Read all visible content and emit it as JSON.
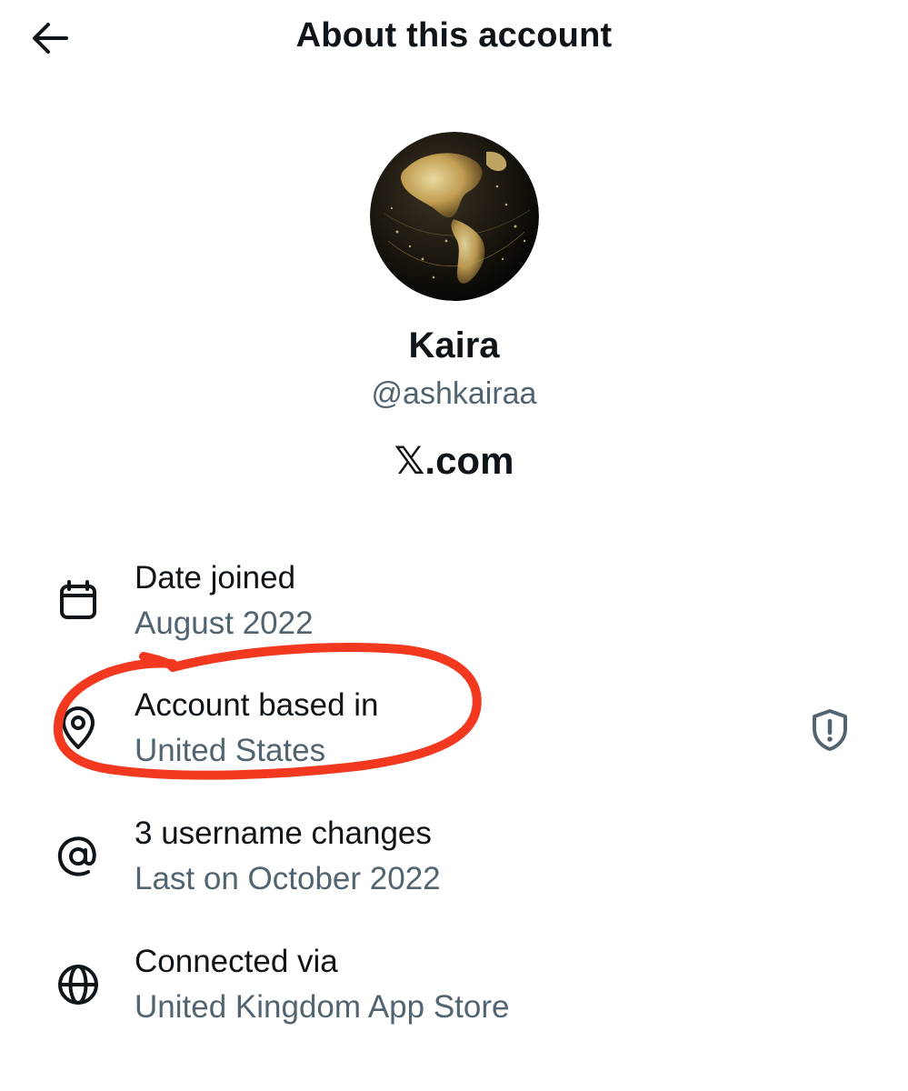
{
  "header": {
    "title": "About this account"
  },
  "profile": {
    "name": "Kaira",
    "handle": "@ashkairaa",
    "domain": "𝕏.com"
  },
  "details": {
    "date_joined": {
      "title": "Date joined",
      "value": "August 2022",
      "icon": "calendar-icon"
    },
    "based_in": {
      "title": "Account based in",
      "value": "United States",
      "icon": "location-pin-icon",
      "action_icon": "shield-alert-icon"
    },
    "username_changes": {
      "title": "3 username changes",
      "value": "Last on October 2022",
      "icon": "at-sign-icon"
    },
    "connected_via": {
      "title": "Connected via",
      "value": "United Kingdom App Store",
      "icon": "globe-icon"
    }
  },
  "colors": {
    "text_primary": "#0f1419",
    "text_secondary": "#536471",
    "annotation": "#f2391f"
  }
}
